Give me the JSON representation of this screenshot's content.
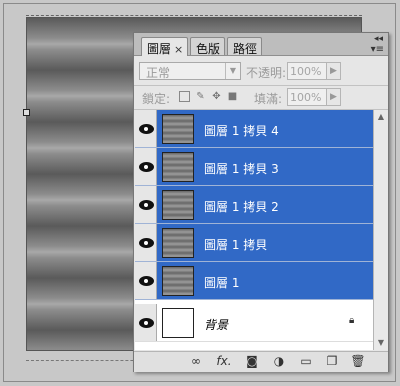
{
  "panel": {
    "tabs": [
      {
        "label": "圖層",
        "close": "×"
      },
      {
        "label": "色版"
      },
      {
        "label": "路徑"
      }
    ],
    "collapse_glyph": "◂◂",
    "menu_glyph": "▾≡"
  },
  "options": {
    "blend_mode": "正常",
    "opacity_label": "不透明:",
    "opacity_value": "100%",
    "lock_label": "鎖定:",
    "fill_label": "填滿:",
    "fill_value": "100%"
  },
  "layers": [
    {
      "name": "圖層 1 拷貝 4",
      "selected": true,
      "visible": true
    },
    {
      "name": "圖層 1 拷貝 3",
      "selected": true,
      "visible": true
    },
    {
      "name": "圖層 1 拷貝 2",
      "selected": true,
      "visible": true
    },
    {
      "name": "圖層 1 拷貝",
      "selected": true,
      "visible": true
    },
    {
      "name": "圖層 1",
      "selected": true,
      "visible": true
    },
    {
      "name": "背景",
      "selected": false,
      "visible": true,
      "locked": true
    }
  ],
  "toolbar_icons": [
    "link-icon",
    "fx-icon",
    "mask-icon",
    "adjustment-icon",
    "folder-icon",
    "new-layer-icon",
    "trash-icon"
  ],
  "colors": {
    "selection": "#3169c6",
    "panel_bg": "#e6e6e6",
    "workspace_bg": "#c8c8c8"
  }
}
